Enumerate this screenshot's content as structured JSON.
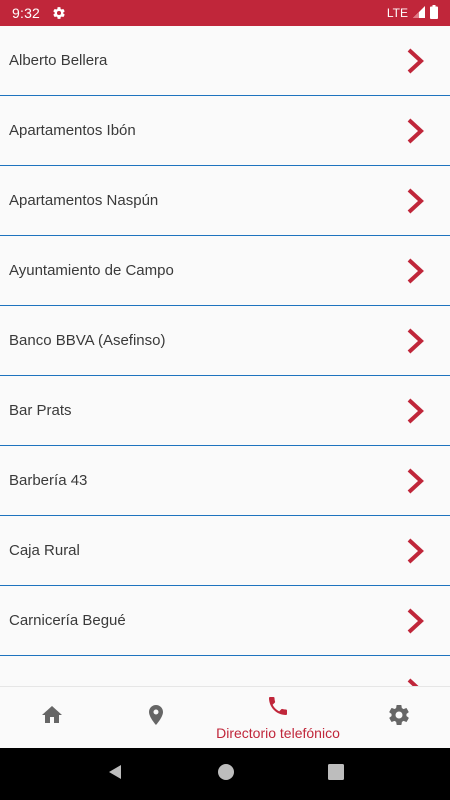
{
  "status_bar": {
    "time": "9:32",
    "network": "LTE"
  },
  "directory": {
    "items": [
      {
        "label": "Alberto Bellera"
      },
      {
        "label": "Apartamentos Ibón"
      },
      {
        "label": "Apartamentos Naspún"
      },
      {
        "label": "Ayuntamiento de Campo"
      },
      {
        "label": "Banco BBVA (Asefinso)"
      },
      {
        "label": "Bar Prats"
      },
      {
        "label": "Barbería 43"
      },
      {
        "label": "Caja Rural"
      },
      {
        "label": "Carnicería Begué"
      },
      {
        "label": ""
      }
    ]
  },
  "bottom_nav": {
    "items": [
      {
        "icon": "home-icon",
        "label": ""
      },
      {
        "icon": "location-pin-icon",
        "label": ""
      },
      {
        "icon": "phone-icon",
        "label": "Directorio telefónico",
        "active": true
      },
      {
        "icon": "gear-icon",
        "label": ""
      }
    ]
  },
  "colors": {
    "accent": "#c0263a",
    "divider": "#1e73be",
    "text": "#3a3a3a",
    "nav_icon": "#666666"
  }
}
